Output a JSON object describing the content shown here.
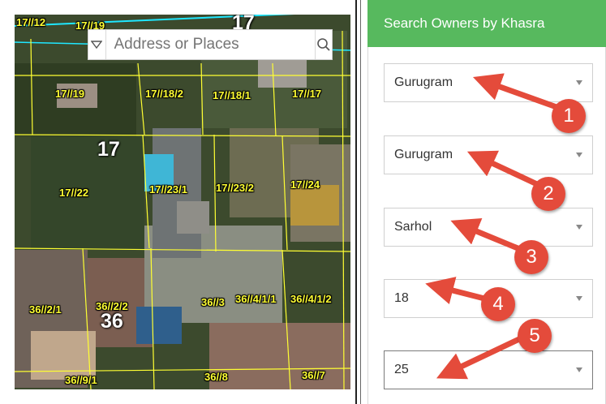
{
  "search": {
    "placeholder": "Address or Places"
  },
  "map": {
    "block_labels": [
      "17",
      "17",
      "36"
    ],
    "parcel_labels": [
      "17//12",
      "17//19",
      "17//19",
      "17//18/2",
      "17//18/1",
      "17//17",
      "17//22",
      "17//23/1",
      "17//23/2",
      "17//24",
      "36//2/1",
      "36//2/2",
      "36//3",
      "36//4/1/1",
      "36//4/1/2",
      "36//9/1",
      "36//8",
      "36//7"
    ]
  },
  "panel": {
    "header": "Search Owners by Khasra",
    "dropdowns": [
      "Gurugram",
      "Gurugram",
      "Sarhol",
      "18",
      "25"
    ]
  },
  "annotations": [
    "1",
    "2",
    "3",
    "4",
    "5"
  ],
  "colors": {
    "panel_header": "#57b95e",
    "arrow": "#e44b3b",
    "parcel_line": "#ffff33",
    "boundary_line": "#1fe7ff"
  }
}
